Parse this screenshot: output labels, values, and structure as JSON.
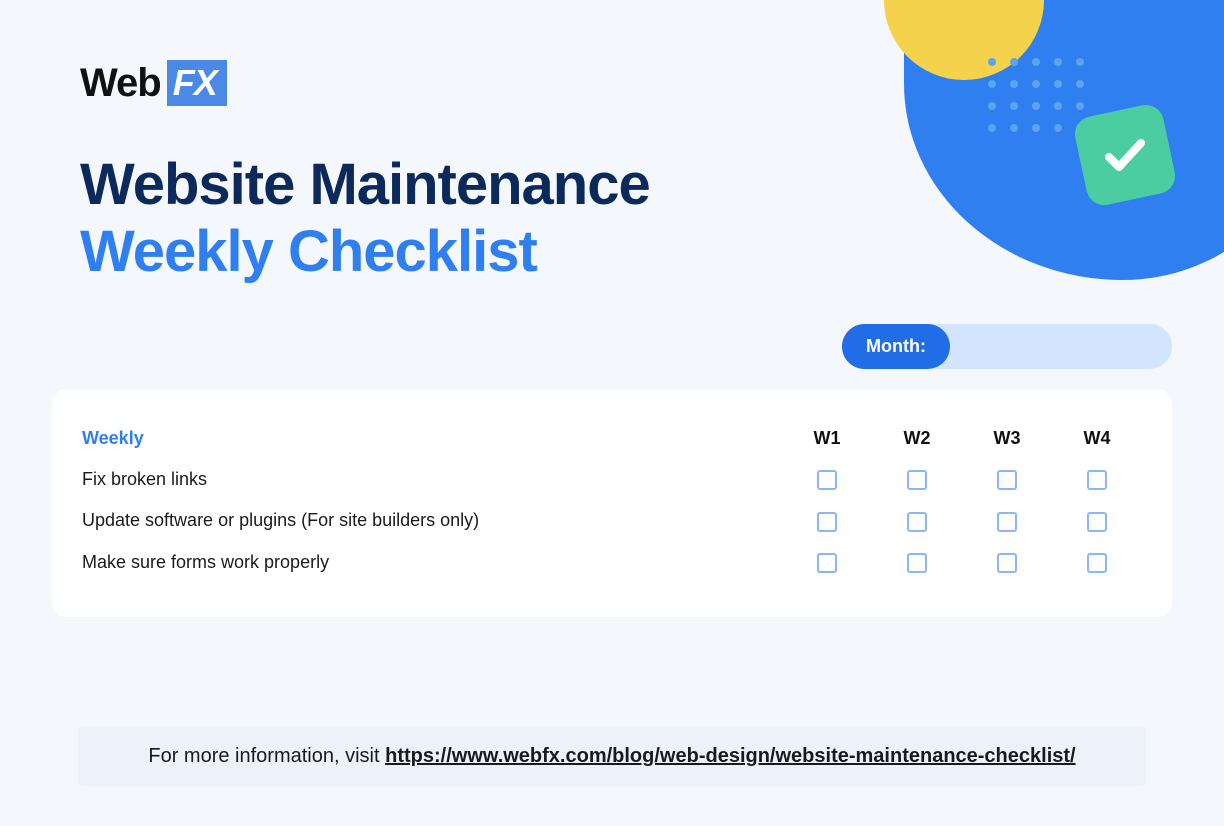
{
  "logo": {
    "text": "Web",
    "box": "FX"
  },
  "headline": {
    "line1": "Website Maintenance",
    "line2": "Weekly Checklist"
  },
  "month_label": "Month:",
  "table": {
    "section_header": "Weekly",
    "columns": [
      "W1",
      "W2",
      "W3",
      "W4"
    ],
    "rows": [
      "Fix broken links",
      "Update software or plugins (For site builders only)",
      "Make sure forms work properly"
    ]
  },
  "footer": {
    "prefix": "For more information, visit ",
    "url": "https://www.webfx.com/blog/web-design/website-maintenance-checklist/"
  }
}
